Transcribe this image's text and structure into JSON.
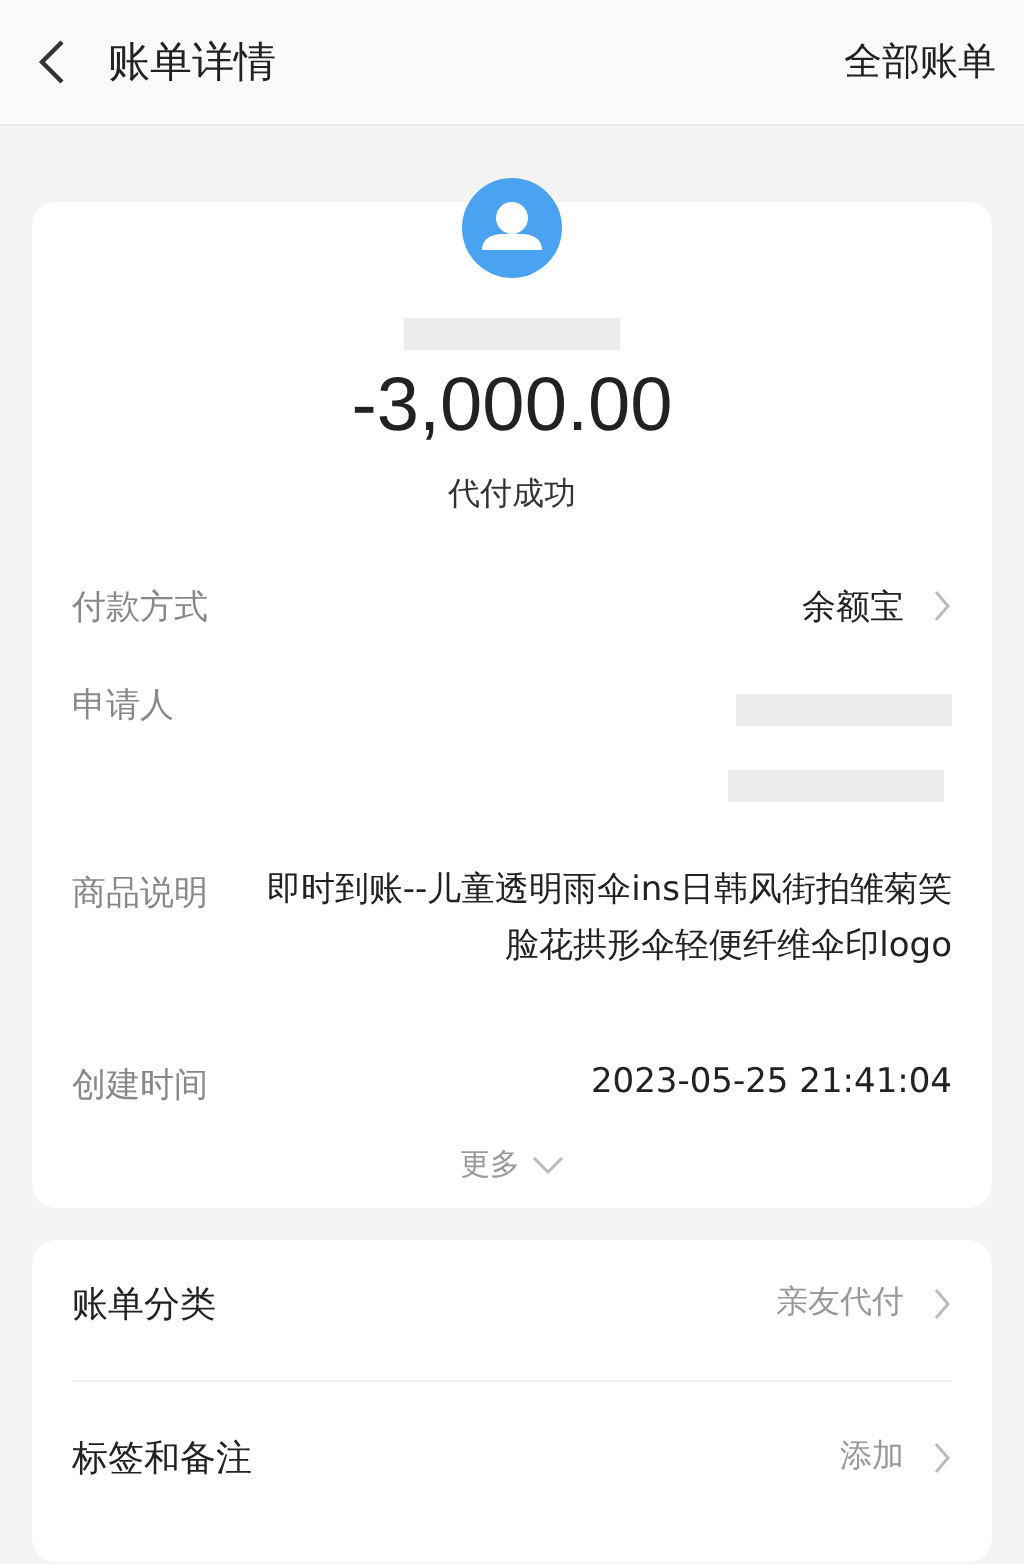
{
  "header": {
    "title": "账单详情",
    "action": "全部账单"
  },
  "summary": {
    "amount": "-3,000.00",
    "status": "代付成功"
  },
  "details": [
    {
      "kind": "link",
      "label": "付款方式",
      "value": "余额宝"
    },
    {
      "kind": "redacted",
      "label": "申请人"
    },
    {
      "kind": "text",
      "label": "商品说明",
      "value": "即时到账--儿童透明雨伞ins日韩风街拍雏菊笑脸花拱形伞轻便纤维伞印logo"
    },
    {
      "kind": "text",
      "label": "创建时间",
      "value": "2023-05-25 21:41:04"
    }
  ],
  "more": {
    "label": "更多",
    "expanded": false
  },
  "options": [
    {
      "label": "账单分类",
      "value": "亲友代付"
    },
    {
      "label": "标签和备注",
      "value": "添加"
    }
  ]
}
